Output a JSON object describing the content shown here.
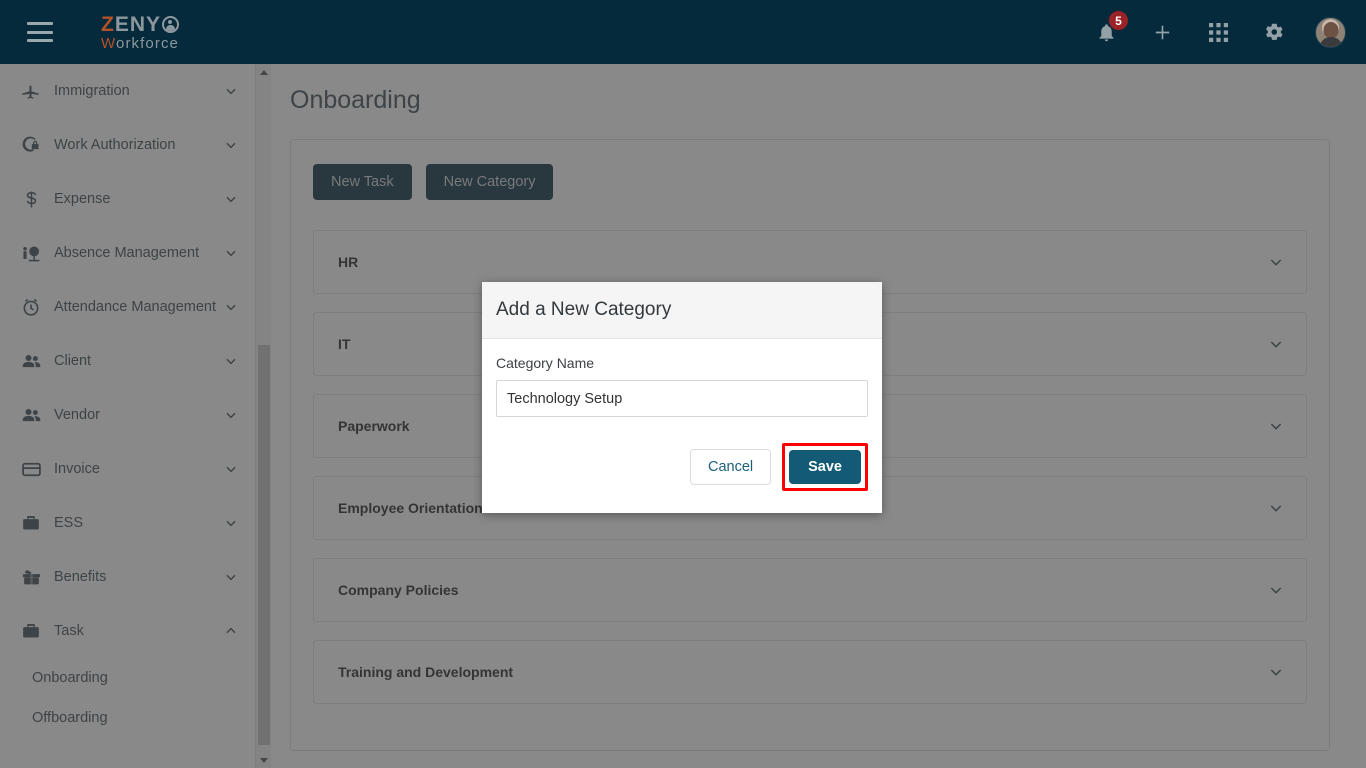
{
  "topbar": {
    "menu_icon": "hamburger-menu-icon",
    "logo": {
      "line1_accent": "Z",
      "line1_rest": "ENY",
      "line2_accent": "W",
      "line2_rest": "orkforce"
    },
    "notification_count": "5",
    "icons": [
      "bell-icon",
      "plus-icon",
      "apps-grid-icon",
      "gear-icon",
      "avatar"
    ]
  },
  "sidebar": {
    "items": [
      {
        "label": "Immigration",
        "icon": "airplane-icon",
        "expanded": false
      },
      {
        "label": "Work Authorization",
        "icon": "globe-lock-icon",
        "expanded": false
      },
      {
        "label": "Expense",
        "icon": "dollar-icon",
        "expanded": false
      },
      {
        "label": "Absence Management",
        "icon": "tree-person-icon",
        "expanded": false
      },
      {
        "label": "Attendance Management",
        "icon": "clock-icon",
        "expanded": false
      },
      {
        "label": "Client",
        "icon": "people-icon",
        "expanded": false
      },
      {
        "label": "Vendor",
        "icon": "people-icon",
        "expanded": false
      },
      {
        "label": "Invoice",
        "icon": "card-icon",
        "expanded": false
      },
      {
        "label": "ESS",
        "icon": "briefcase-icon",
        "expanded": false
      },
      {
        "label": "Benefits",
        "icon": "gift-icon",
        "expanded": false
      },
      {
        "label": "Task",
        "icon": "briefcase-icon",
        "expanded": true
      }
    ],
    "sub_items": [
      {
        "label": "Onboarding",
        "active": true
      },
      {
        "label": "Offboarding",
        "active": false
      }
    ]
  },
  "main": {
    "page_title": "Onboarding",
    "buttons": {
      "new_task": "New Task",
      "new_category": "New Category"
    },
    "categories": [
      {
        "name": "HR"
      },
      {
        "name": "IT"
      },
      {
        "name": "Paperwork"
      },
      {
        "name": "Employee Orientation"
      },
      {
        "name": "Company Policies"
      },
      {
        "name": "Training and Development"
      }
    ]
  },
  "modal": {
    "title": "Add a New Category",
    "field_label": "Category Name",
    "input_value": "Technology Setup",
    "input_placeholder": "",
    "cancel_label": "Cancel",
    "save_label": "Save"
  },
  "colors": {
    "topbar_bg": "#042a3c",
    "logo_accent": "#b4522a",
    "primary_button": "#042a3c",
    "save_button": "#125a75",
    "cancel_text": "#1b6079",
    "badge": "#9b2226",
    "highlight": "#ff0000"
  }
}
